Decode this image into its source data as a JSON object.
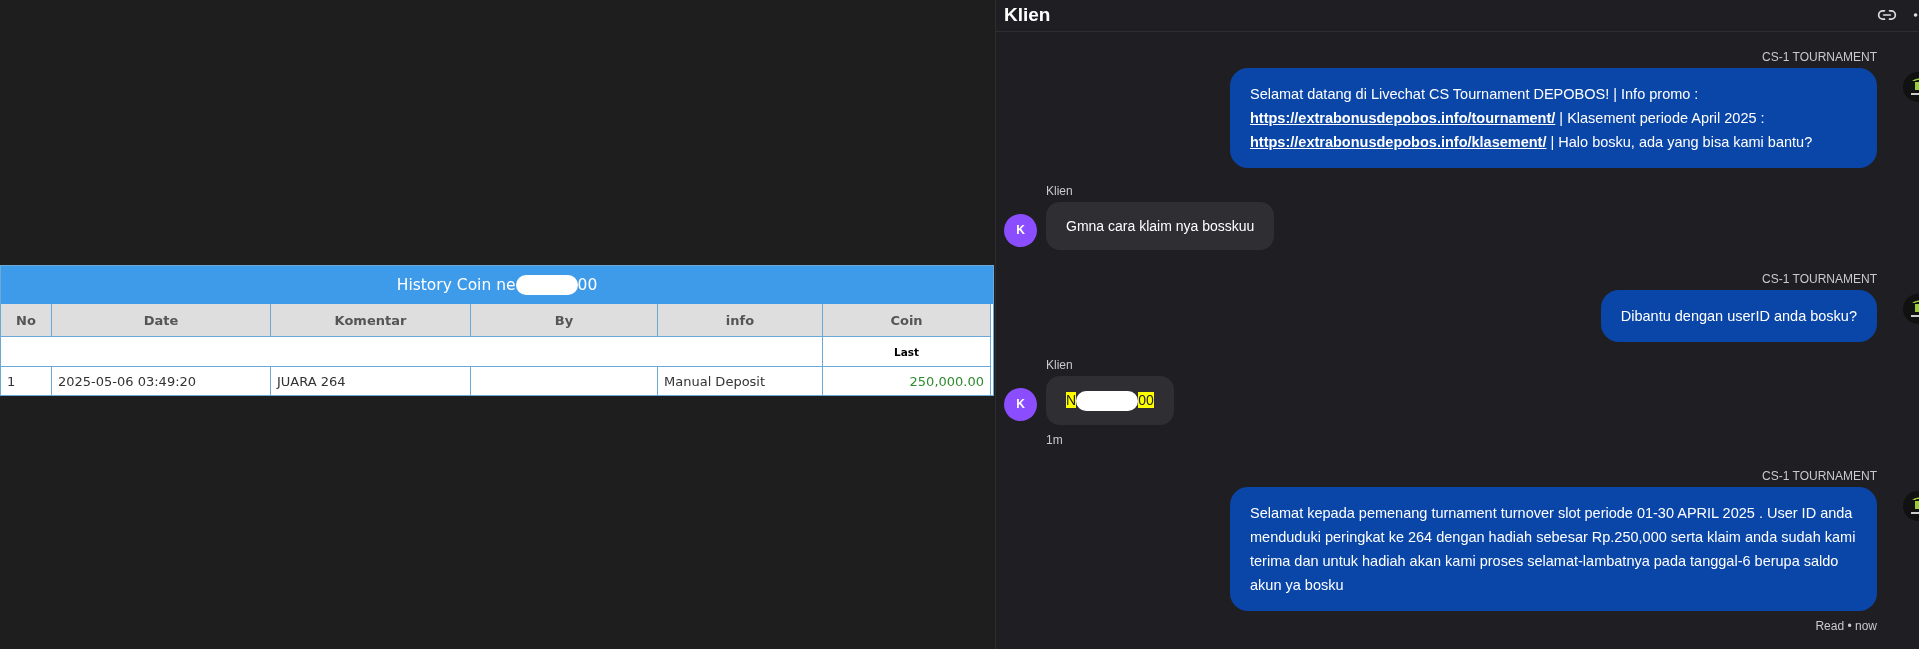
{
  "history_table": {
    "title": [
      {
        "kind": "text",
        "text": "History Coin ne"
      },
      {
        "kind": "redacted"
      },
      {
        "kind": "text",
        "text": "00"
      }
    ],
    "columns": [
      "No",
      "Date",
      "Komentar",
      "By",
      "info",
      "Coin"
    ],
    "coin_subheader": "Last",
    "rows": [
      {
        "no": "1",
        "date": "2025-05-06 03:49:20",
        "komentar": "JUARA 264",
        "info": "Manual Deposit",
        "coin": "250,000.00"
      }
    ]
  },
  "chat": {
    "title": "Klien",
    "messages": [
      {
        "kind": "agent",
        "sender": "CS-1 TOURNAMENT",
        "parts": [
          {
            "kind": "text",
            "text": "Selamat datang di Livechat CS Tournament DEPOBOS! | Info promo : "
          },
          {
            "kind": "link",
            "text": "https://extrabonusdepobos.info/tournament/"
          },
          {
            "kind": "text",
            "text": " | Klasement periode April 2025 : "
          },
          {
            "kind": "link",
            "text": "https://extrabonusdepobos.info/klasement/"
          },
          {
            "kind": "text",
            "text": " | Halo bosku, ada yang bisa kami bantu?"
          }
        ]
      },
      {
        "kind": "client",
        "sender": "Klien",
        "avatar": "K",
        "highlight": false,
        "parts": [
          {
            "kind": "text",
            "text": "Gmna cara klaim nya bosskuu"
          }
        ]
      },
      {
        "kind": "agent",
        "sender": "CS-1 TOURNAMENT",
        "parts": [
          {
            "kind": "text",
            "text": "Dibantu dengan userID anda bosku?"
          }
        ]
      },
      {
        "kind": "client",
        "sender": "Klien",
        "avatar": "K",
        "highlight": true,
        "parts": [
          {
            "kind": "text",
            "text": "N"
          },
          {
            "kind": "redacted"
          },
          {
            "kind": "text",
            "text": "00"
          }
        ],
        "time": "1m"
      },
      {
        "kind": "agent",
        "sender": "CS-1 TOURNAMENT",
        "parts": [
          {
            "kind": "text",
            "text": "Selamat kepada pemenang turnament turnover slot periode 01-30 APRIL 2025 . User ID anda menduduki peringkat ke 264 dengan hadiah sebesar Rp.250,000 serta klaim anda sudah kami terima dan untuk hadiah akan kami proses selamat-lambatnya pada tanggal-6 berupa saldo akun ya bosku"
          }
        ],
        "status": "Read • now"
      }
    ]
  }
}
